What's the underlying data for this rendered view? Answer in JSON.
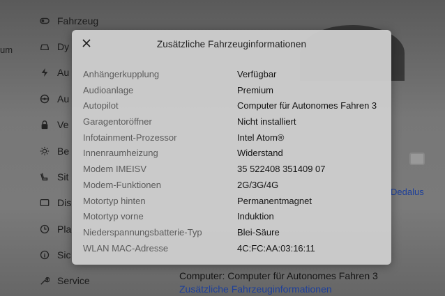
{
  "background": {
    "left_text": "um",
    "sidebar": [
      {
        "label": "Fahrzeug",
        "icon": "toggle-icon"
      },
      {
        "label": "Dy",
        "icon": "car-icon"
      },
      {
        "label": "Au",
        "icon": "lightning-icon"
      },
      {
        "label": "Au",
        "icon": "steering-wheel-icon"
      },
      {
        "label": "Ve",
        "icon": "lock-icon"
      },
      {
        "label": "Be",
        "icon": "sun-icon"
      },
      {
        "label": "Sit",
        "icon": "seat-icon"
      },
      {
        "label": "Dis",
        "icon": "display-icon"
      },
      {
        "label": "Pla",
        "icon": "clock-icon"
      },
      {
        "label": "Sic",
        "icon": "info-icon"
      },
      {
        "label": "Service",
        "icon": "wrench-icon"
      }
    ],
    "dedalus_text": "Dedalus",
    "computer_text": "Computer: Computer für Autonomes Fahren 3",
    "link_text": "Zusätzliche Fahrzeuginformationen"
  },
  "modal": {
    "title": "Zusätzliche Fahrzeuginformationen",
    "close_icon": "close-icon",
    "rows": [
      {
        "label": "Anhängerkupplung",
        "value": "Verfügbar"
      },
      {
        "label": "Audioanlage",
        "value": "Premium"
      },
      {
        "label": "Autopilot",
        "value": "Computer für Autonomes Fahren 3"
      },
      {
        "label": "Garagentoröffner",
        "value": "Nicht installiert"
      },
      {
        "label": "Infotainment-Prozessor",
        "value": "Intel Atom®"
      },
      {
        "label": "Innenraumheizung",
        "value": "Widerstand"
      },
      {
        "label": "Modem IMEISV",
        "value": "35 522408 351409 07"
      },
      {
        "label": "Modem-Funktionen",
        "value": "2G/3G/4G"
      },
      {
        "label": "Motortyp hinten",
        "value": "Permanentmagnet"
      },
      {
        "label": "Motortyp vorne",
        "value": "Induktion"
      },
      {
        "label": "Niederspannungsbatterie-Typ",
        "value": "Blei-Säure"
      },
      {
        "label": "WLAN MAC-Adresse",
        "value": "4C:FC:AA:03:16:11"
      }
    ]
  }
}
